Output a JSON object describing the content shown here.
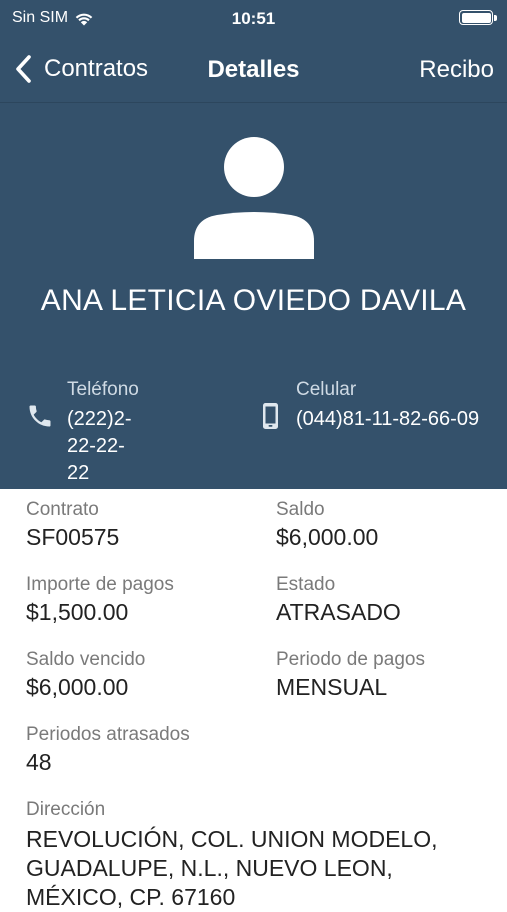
{
  "status_bar": {
    "carrier": "Sin SIM",
    "time": "10:51",
    "wifi_icon": "wifi-icon",
    "battery_icon": "battery-icon"
  },
  "nav": {
    "back_label": "Contratos",
    "title": "Detalles",
    "action_label": "Recibo",
    "back_icon": "chevron-left-icon"
  },
  "client": {
    "name": "ANA LETICIA OVIEDO DAVILA",
    "avatar_icon": "person-icon",
    "phone_label": "Teléfono",
    "phone_value": "(222)2-22-22-22",
    "phone_icon": "phone-icon",
    "cell_label": "Celular",
    "cell_value": "(044)81-11-82-66-09",
    "cell_icon": "mobile-phone-icon"
  },
  "contract": {
    "contract_label": "Contrato",
    "contract_value": "SF00575",
    "balance_label": "Saldo",
    "balance_value": "$6,000.00",
    "payment_amount_label": "Importe de pagos",
    "payment_amount_value": "$1,500.00",
    "status_label": "Estado",
    "status_value": "ATRASADO",
    "overdue_balance_label": "Saldo vencido",
    "overdue_balance_value": "$6,000.00",
    "payment_period_label": "Periodo de pagos",
    "payment_period_value": "MENSUAL",
    "overdue_periods_label": "Periodos atrasados",
    "overdue_periods_value": "48",
    "address_label": "Dirección",
    "address_value": "REVOLUCIÓN, COL. UNION MODELO, GUADALUPE, N.L., NUEVO LEON, MÉXICO, CP. 67160"
  },
  "colors": {
    "header_bg": "#34516b",
    "text_dark": "#222222",
    "text_label": "#7a7a7a"
  }
}
